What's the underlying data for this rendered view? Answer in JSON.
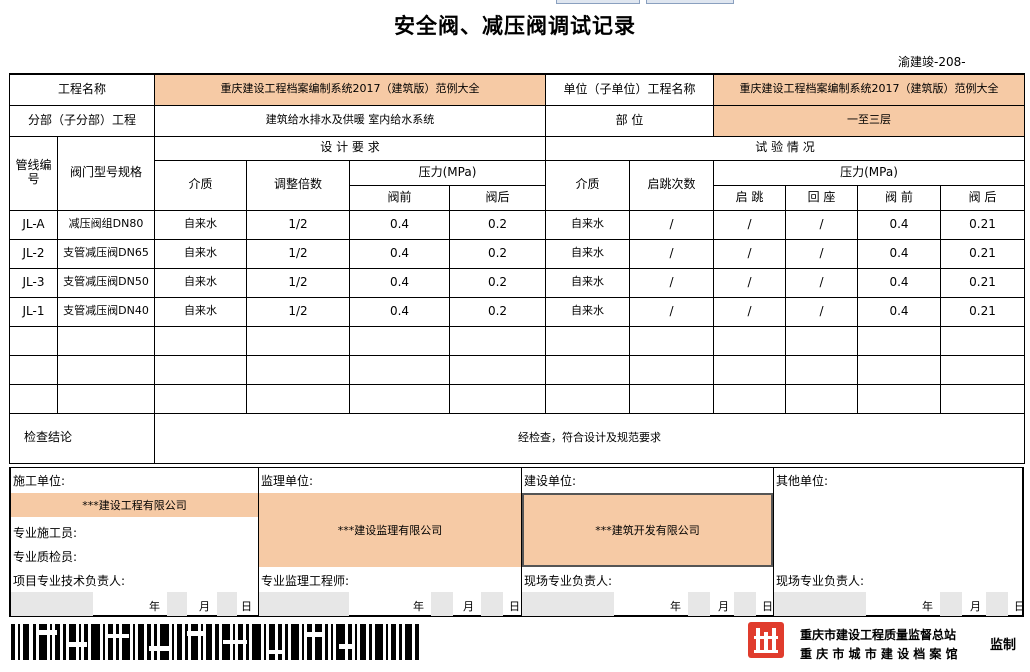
{
  "title": "安全阀、减压阀调试记录",
  "doc_no_label": "渝建竣-208-",
  "header": {
    "project_label": "工程名称",
    "project_value": "重庆建设工程档案编制系统2017（建筑版）范例大全",
    "unit_label": "单位（子单位）工程名称",
    "unit_value": "重庆建设工程档案编制系统2017（建筑版）范例大全",
    "subdiv_label": "分部（子分部）工程",
    "subdiv_value": "建筑给水排水及供暖 室内给水系统",
    "location_label": "部 位",
    "location_value": "一至三层"
  },
  "cols": {
    "pipe_no": "管线编号",
    "valve_spec": "阀门型号规格",
    "design_req": "设 计 要 求",
    "test_cond": "试 验 情 况",
    "medium": "介质",
    "adjust_ratio": "调整倍数",
    "pressure": "压力(MPa)",
    "before": "阀前",
    "after": "阀后",
    "jump_count": "启跳次数",
    "jump": "启 跳",
    "reseat": "回 座",
    "before2": "阀 前",
    "after2": "阀 后"
  },
  "rows": [
    {
      "id": "JL-A",
      "spec": "减压阀组DN80",
      "medium": "自来水",
      "ratio": "1/2",
      "d_before": "0.4",
      "d_after": "0.2",
      "t_medium": "自来水",
      "count": "/",
      "jump": "/",
      "reseat": "/",
      "t_before": "0.4",
      "t_after": "0.21"
    },
    {
      "id": "JL-2",
      "spec": "支管减压阀DN65",
      "medium": "自来水",
      "ratio": "1/2",
      "d_before": "0.4",
      "d_after": "0.2",
      "t_medium": "自来水",
      "count": "/",
      "jump": "/",
      "reseat": "/",
      "t_before": "0.4",
      "t_after": "0.21"
    },
    {
      "id": "JL-3",
      "spec": "支管减压阀DN50",
      "medium": "自来水",
      "ratio": "1/2",
      "d_before": "0.4",
      "d_after": "0.2",
      "t_medium": "自来水",
      "count": "/",
      "jump": "/",
      "reseat": "/",
      "t_before": "0.4",
      "t_after": "0.21"
    },
    {
      "id": "JL-1",
      "spec": "支管减压阀DN40",
      "medium": "自来水",
      "ratio": "1/2",
      "d_before": "0.4",
      "d_after": "0.2",
      "t_medium": "自来水",
      "count": "/",
      "jump": "/",
      "reseat": "/",
      "t_before": "0.4",
      "t_after": "0.21"
    }
  ],
  "conclusion_label": "检查结论",
  "conclusion_value": "经检查，符合设计及规范要求",
  "signoff": {
    "construction": {
      "label": "施工单位:",
      "company": "***建设工程有限公司",
      "worker": "专业施工员:",
      "inspector": "专业质检员:",
      "tech_lead": "项目专业技术负责人:"
    },
    "supervision": {
      "label": "监理单位:",
      "company": "***建设监理有限公司",
      "engineer": "专业监理工程师:"
    },
    "builder": {
      "label": "建设单位:",
      "company": "***建筑开发有限公司",
      "lead": "现场专业负责人:"
    },
    "other": {
      "label": "其他单位:",
      "lead": "现场专业负责人:"
    },
    "year": "年",
    "month": "月",
    "day": "日"
  },
  "footer": {
    "agency1": "重庆市建设工程质量监督总站",
    "agency2": "重 庆 市 城 市 建 设 档 案 馆",
    "jianzhi": "监制"
  },
  "colors": {
    "highlight": "#f6caa5",
    "logo": "#e03c2d"
  }
}
